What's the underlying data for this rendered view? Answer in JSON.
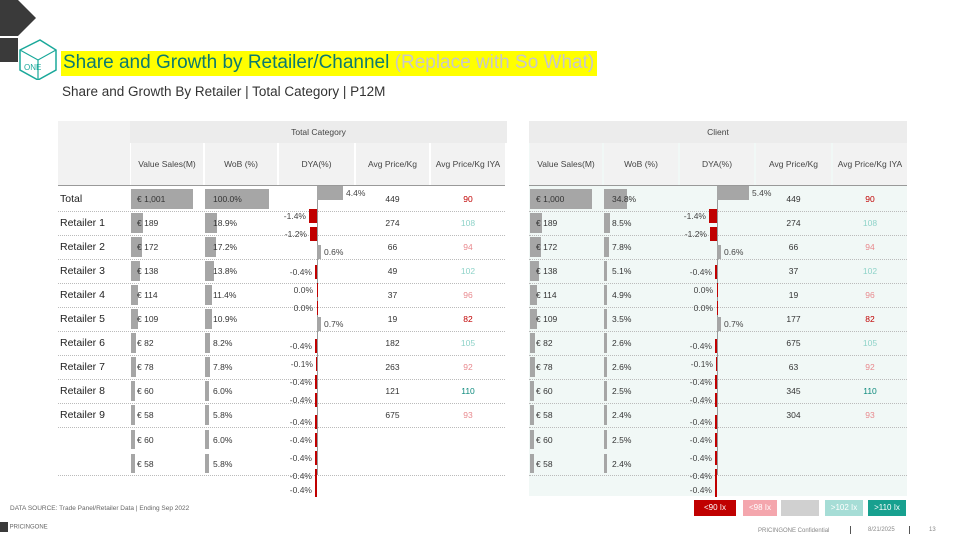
{
  "title": "Share and Growth by Retailer/Channel",
  "title_sowhat": "(Replace with So What)",
  "subtitle": "Share and Growth By Retailer | Total Category | P12M",
  "logo": {
    "word": "ONE"
  },
  "left_table": {
    "group_label": "Total Category",
    "columns": [
      {
        "line1": "Value Sales",
        "line2": "(M)"
      },
      {
        "line1": "WoB (%)",
        "line2": ""
      },
      {
        "line1": "DYA",
        "line2": "(%)"
      },
      {
        "line1": "Avg Price",
        "line2": "/Kg"
      },
      {
        "line1": "Avg Price",
        "line2": "/Kg IYA"
      }
    ],
    "row_labels": [
      "Total",
      "Retailer 1",
      "Retailer 2",
      "Retailer 3",
      "Retailer 4",
      "Retailer 5",
      "Retailer 6",
      "Retailer 7",
      "Retailer 8",
      "Retailer 9"
    ],
    "value_sales": [
      {
        "label": "€ 1,001",
        "value": 1001
      },
      {
        "label": "€ 189",
        "value": 189
      },
      {
        "label": "€ 172",
        "value": 172
      },
      {
        "label": "€ 138",
        "value": 138
      },
      {
        "label": "€ 114",
        "value": 114
      },
      {
        "label": "€ 109",
        "value": 109
      },
      {
        "label": "€ 82",
        "value": 82
      },
      {
        "label": "€ 78",
        "value": 78
      },
      {
        "label": "€ 60",
        "value": 60
      },
      {
        "label": "€ 58",
        "value": 58
      }
    ],
    "wob": [
      {
        "label": "100.0%",
        "value": 100.0
      },
      {
        "label": "18.9%",
        "value": 18.9
      },
      {
        "label": "17.2%",
        "value": 17.2
      },
      {
        "label": "13.8%",
        "value": 13.8
      },
      {
        "label": "11.4%",
        "value": 11.4
      },
      {
        "label": "10.9%",
        "value": 10.9
      },
      {
        "label": "8.2%",
        "value": 8.2
      },
      {
        "label": "7.8%",
        "value": 7.8
      },
      {
        "label": "6.0%",
        "value": 6.0
      },
      {
        "label": "5.8%",
        "value": 5.8
      }
    ],
    "dya": [
      {
        "label": "4.4%",
        "value": 4.4
      },
      {
        "label": "-1.4%",
        "value": -1.4
      },
      {
        "label": "-1.2%",
        "value": -1.2
      },
      {
        "label": "0.6%",
        "value": 0.6
      },
      {
        "label": "-0.4%",
        "value": -0.4
      },
      {
        "label": "0.0%",
        "value": 0.0
      },
      {
        "label": "0.0%",
        "value": 0.0
      },
      {
        "label": "0.7%",
        "value": 0.7
      },
      {
        "label": "-0.4%",
        "value": -0.4
      },
      {
        "label": "-0.1%",
        "value": -0.1
      },
      {
        "label": "-0.4%",
        "value": -0.4
      },
      {
        "label": "-0.4%",
        "value": -0.4
      },
      {
        "label": "-0.4%",
        "value": -0.4
      },
      {
        "label": "-0.4%",
        "value": -0.4
      },
      {
        "label": "-0.4%",
        "value": -0.4
      },
      {
        "label": "-0.4%",
        "value": -0.4
      },
      {
        "label": "-0.4%",
        "value": -0.4
      }
    ],
    "avg_price": [
      "449",
      "274",
      "66",
      "49",
      "37",
      "19",
      "182",
      "263",
      "121",
      "675"
    ],
    "avg_price_iya": [
      {
        "label": "90",
        "band": "red"
      },
      {
        "label": "108",
        "band": "lteal"
      },
      {
        "label": "94",
        "band": "pink"
      },
      {
        "label": "102",
        "band": "lteal"
      },
      {
        "label": "96",
        "band": "pink"
      },
      {
        "label": "82",
        "band": "red"
      },
      {
        "label": "105",
        "band": "lteal"
      },
      {
        "label": "92",
        "band": "pink"
      },
      {
        "label": "110",
        "band": "teal"
      },
      {
        "label": "93",
        "band": "pink"
      }
    ]
  },
  "right_table": {
    "group_label": "Client",
    "columns": [
      {
        "line1": "Value Sales",
        "line2": "(M)"
      },
      {
        "line1": "WoB (%)",
        "line2": ""
      },
      {
        "line1": "DYA",
        "line2": "(%)"
      },
      {
        "line1": "Avg Price",
        "line2": "/Kg"
      },
      {
        "line1": "Avg Price",
        "line2": "/Kg IYA"
      }
    ],
    "value_sales": [
      {
        "label": "€ 1,000",
        "value": 1000
      },
      {
        "label": "€ 189",
        "value": 189
      },
      {
        "label": "€ 172",
        "value": 172
      },
      {
        "label": "€ 138",
        "value": 138
      },
      {
        "label": "€ 114",
        "value": 114
      },
      {
        "label": "€ 109",
        "value": 109
      },
      {
        "label": "€ 82",
        "value": 82
      },
      {
        "label": "€ 78",
        "value": 78
      },
      {
        "label": "€ 60",
        "value": 60
      },
      {
        "label": "€ 58",
        "value": 58
      }
    ],
    "wob": [
      {
        "label": "34.8%",
        "value": 34.8
      },
      {
        "label": "8.5%",
        "value": 8.5
      },
      {
        "label": "7.8%",
        "value": 7.8
      },
      {
        "label": "5.1%",
        "value": 5.1
      },
      {
        "label": "4.9%",
        "value": 4.9
      },
      {
        "label": "3.5%",
        "value": 3.5
      },
      {
        "label": "2.6%",
        "value": 2.6
      },
      {
        "label": "2.6%",
        "value": 2.6
      },
      {
        "label": "2.5%",
        "value": 2.5
      },
      {
        "label": "2.4%",
        "value": 2.4
      }
    ],
    "dya": [
      {
        "label": "5.4%",
        "value": 5.4
      },
      {
        "label": "-1.4%",
        "value": -1.4
      },
      {
        "label": "-1.2%",
        "value": -1.2
      },
      {
        "label": "0.6%",
        "value": 0.6
      },
      {
        "label": "-0.4%",
        "value": -0.4
      },
      {
        "label": "0.0%",
        "value": 0.0
      },
      {
        "label": "0.0%",
        "value": 0.0
      },
      {
        "label": "0.7%",
        "value": 0.7
      },
      {
        "label": "-0.4%",
        "value": -0.4
      },
      {
        "label": "-0.1%",
        "value": -0.1
      },
      {
        "label": "-0.4%",
        "value": -0.4
      },
      {
        "label": "-0.4%",
        "value": -0.4
      },
      {
        "label": "-0.4%",
        "value": -0.4
      },
      {
        "label": "-0.4%",
        "value": -0.4
      },
      {
        "label": "-0.4%",
        "value": -0.4
      },
      {
        "label": "-0.4%",
        "value": -0.4
      },
      {
        "label": "-0.4%",
        "value": -0.4
      }
    ],
    "avg_price": [
      "449",
      "274",
      "66",
      "37",
      "19",
      "177",
      "675",
      "63",
      "345",
      "304"
    ],
    "avg_price_iya": [
      {
        "label": "90",
        "band": "red"
      },
      {
        "label": "108",
        "band": "lteal"
      },
      {
        "label": "94",
        "band": "pink"
      },
      {
        "label": "102",
        "band": "lteal"
      },
      {
        "label": "96",
        "band": "pink"
      },
      {
        "label": "82",
        "band": "red"
      },
      {
        "label": "105",
        "band": "lteal"
      },
      {
        "label": "92",
        "band": "pink"
      },
      {
        "label": "110",
        "band": "teal"
      },
      {
        "label": "93",
        "band": "pink"
      }
    ]
  },
  "legend": [
    {
      "label": "<90 Ix",
      "color": "#c00000"
    },
    {
      "label": "<98 Ix",
      "color": "#f4a6ad"
    },
    {
      "label": "",
      "color": "#d0d0d0"
    },
    {
      "label": ">102 Ix",
      "color": "#a6ddd6"
    },
    {
      "label": ">110 Ix",
      "color": "#17a08f"
    }
  ],
  "colors": {
    "red": "#c00000",
    "pink": "#e8898e",
    "lteal": "#8fd3c9",
    "teal": "#0e8a7d",
    "title_teal": "#0d7a6f",
    "highlight": "#ffff00",
    "bar_grey": "#a6a6a6"
  },
  "footer": {
    "source": "DATA SOURCE: Trade Panel/Retailer Data | Ending Sep 2022",
    "brand": "PRICINGONE",
    "confidential": "PRICINGONE Confidential",
    "date": "8/21/2025",
    "page": "13"
  }
}
